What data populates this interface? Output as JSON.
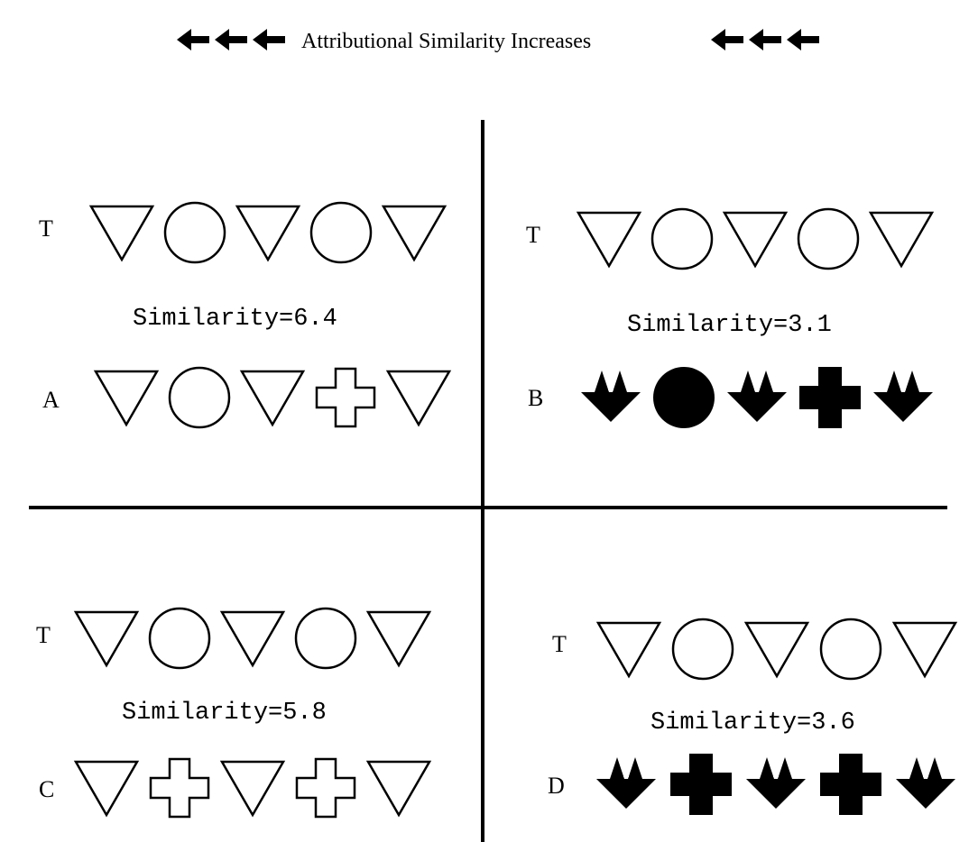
{
  "header": {
    "title": "Attributional Similarity Increases",
    "arrows_left": [
      "left-arrow",
      "left-arrow",
      "left-arrow"
    ],
    "arrows_right": [
      "left-arrow",
      "left-arrow",
      "left-arrow"
    ]
  },
  "quadrants": [
    {
      "id": "A",
      "target_label": "T",
      "target_shapes": [
        "triangle-down-outline",
        "circle-outline",
        "triangle-down-outline",
        "circle-outline",
        "triangle-down-outline"
      ],
      "similarity_text": "Similarity=6.4",
      "compare_label": "A",
      "compare_shapes": [
        "triangle-down-outline",
        "circle-outline",
        "triangle-down-outline",
        "cross-outline",
        "triangle-down-outline"
      ]
    },
    {
      "id": "B",
      "target_label": "T",
      "target_shapes": [
        "triangle-down-outline",
        "circle-outline",
        "triangle-down-outline",
        "circle-outline",
        "triangle-down-outline"
      ],
      "similarity_text": "Similarity=3.1",
      "compare_label": "B",
      "compare_shapes": [
        "arrowhead-filled",
        "circle-filled",
        "arrowhead-filled",
        "cross-filled",
        "arrowhead-filled"
      ]
    },
    {
      "id": "C",
      "target_label": "T",
      "target_shapes": [
        "triangle-down-outline",
        "circle-outline",
        "triangle-down-outline",
        "circle-outline",
        "triangle-down-outline"
      ],
      "similarity_text": "Similarity=5.8",
      "compare_label": "C",
      "compare_shapes": [
        "triangle-down-outline",
        "cross-outline",
        "triangle-down-outline",
        "cross-outline",
        "triangle-down-outline"
      ]
    },
    {
      "id": "D",
      "target_label": "T",
      "target_shapes": [
        "triangle-down-outline",
        "circle-outline",
        "triangle-down-outline",
        "circle-outline",
        "triangle-down-outline"
      ],
      "similarity_text": "Similarity=3.6",
      "compare_label": "D",
      "compare_shapes": [
        "arrowhead-filled",
        "cross-filled",
        "arrowhead-filled",
        "cross-filled",
        "arrowhead-filled"
      ]
    }
  ],
  "colors": {
    "ink": "#000000",
    "background": "#ffffff"
  }
}
